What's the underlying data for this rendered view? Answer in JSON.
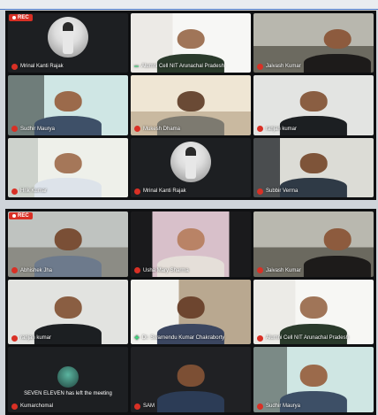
{
  "recording_label": "REC",
  "panel1": {
    "tiles": [
      {
        "name": "Mrinal Kanti Rajak",
        "muted": true
      },
      {
        "name": "Alumni Cell NIT Arunachal Pradesh",
        "muted": false
      },
      {
        "name": "Jaivash Kumar",
        "muted": true
      },
      {
        "name": "Sudhir Maurya",
        "muted": true
      },
      {
        "name": "Mukesh Dhama",
        "muted": true
      },
      {
        "name": "ranjan kumar",
        "muted": true
      },
      {
        "name": "Hrik Kumar",
        "muted": true
      },
      {
        "name": "Mrinal Kanti Rajak",
        "muted": true
      },
      {
        "name": "Subbir Verma",
        "muted": true
      }
    ]
  },
  "panel2": {
    "tiles": [
      {
        "name": "Abhishek Jha",
        "muted": true
      },
      {
        "name": "Usha Mary Sharma",
        "muted": true
      },
      {
        "name": "Jaivash Kumar",
        "muted": true
      },
      {
        "name": "ranjan kumar",
        "muted": true
      },
      {
        "name": "Dr. Swarnendu Kumar Chakraborty",
        "muted": false
      },
      {
        "name": "Alumni Cell NIT Arunachal Pradesh",
        "muted": true
      },
      {
        "name": "Kumarchomal",
        "muted": true,
        "message": "SEVEN ELEVEN has left the meeting"
      },
      {
        "name": "SAM",
        "muted": true
      },
      {
        "name": "Sudhir Maurya",
        "muted": true
      }
    ]
  },
  "colors": {
    "accent": "#4c79c9",
    "muted_mic": "#d93025",
    "meeting_background": "#0f1012"
  }
}
